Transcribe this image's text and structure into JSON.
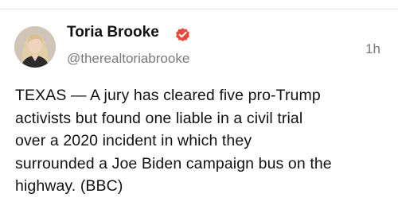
{
  "post": {
    "author": {
      "name": "Toria Brooke",
      "handle": "@therealtoriabrooke",
      "verified": true,
      "verified_icon": "verified-badge-icon",
      "verified_color": "#e64a3c"
    },
    "timestamp": "1h",
    "body_lines": [
      "TEXAS — A jury has cleared five pro-Trump",
      "activists but found one liable in a civil trial",
      "over a 2020 incident in which they",
      "surrounded a Joe Biden campaign bus on the",
      "highway. (BBC)"
    ]
  }
}
